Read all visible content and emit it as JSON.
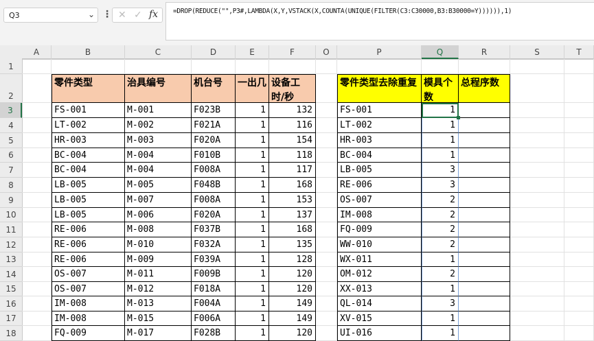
{
  "name_box": {
    "value": "Q3"
  },
  "formula": "=DROP(REDUCE(\"\",P3#,LAMBDA(X,Y,VSTACK(X,COUNTA(UNIQUE(FILTER(C3:C30000,B3:B30000=Y)))))),1)",
  "columns": [
    "A",
    "B",
    "C",
    "D",
    "E",
    "F",
    "O",
    "P",
    "Q",
    "R",
    "S",
    "T"
  ],
  "rows": [
    "1",
    "2",
    "3",
    "4",
    "5",
    "6",
    "7",
    "8",
    "9",
    "10",
    "11",
    "12",
    "13",
    "14",
    "15",
    "16",
    "17",
    "18"
  ],
  "left_table": {
    "headers": [
      "零件类型",
      "治具编号",
      "机台号",
      "一出几",
      "设备工时/秒"
    ],
    "header_color": "#f8cbad",
    "rows": [
      [
        "FS-001",
        "M-001",
        "F023B",
        "1",
        "132"
      ],
      [
        "LT-002",
        "M-002",
        "F021A",
        "1",
        "116"
      ],
      [
        "HR-003",
        "M-003",
        "F020A",
        "1",
        "154"
      ],
      [
        "BC-004",
        "M-004",
        "F010B",
        "1",
        "118"
      ],
      [
        "BC-004",
        "M-004",
        "F008A",
        "1",
        "117"
      ],
      [
        "LB-005",
        "M-005",
        "F048B",
        "1",
        "168"
      ],
      [
        "LB-005",
        "M-007",
        "F008A",
        "1",
        "153"
      ],
      [
        "LB-005",
        "M-006",
        "F020A",
        "1",
        "137"
      ],
      [
        "RE-006",
        "M-008",
        "F037B",
        "1",
        "168"
      ],
      [
        "RE-006",
        "M-010",
        "F032A",
        "1",
        "135"
      ],
      [
        "RE-006",
        "M-009",
        "F039A",
        "1",
        "128"
      ],
      [
        "OS-007",
        "M-011",
        "F009B",
        "1",
        "120"
      ],
      [
        "OS-007",
        "M-012",
        "F018A",
        "1",
        "120"
      ],
      [
        "IM-008",
        "M-013",
        "F004A",
        "1",
        "149"
      ],
      [
        "IM-008",
        "M-015",
        "F006A",
        "1",
        "149"
      ],
      [
        "FQ-009",
        "M-017",
        "F028B",
        "1",
        "120"
      ]
    ]
  },
  "right_table": {
    "headers": [
      "零件类型去除重复",
      "模具个数",
      "总程序数"
    ],
    "header_color": "#ffff00",
    "rows": [
      [
        "FS-001",
        "1",
        ""
      ],
      [
        "LT-002",
        "1",
        ""
      ],
      [
        "HR-003",
        "1",
        ""
      ],
      [
        "BC-004",
        "1",
        ""
      ],
      [
        "LB-005",
        "3",
        ""
      ],
      [
        "RE-006",
        "3",
        ""
      ],
      [
        "OS-007",
        "2",
        ""
      ],
      [
        "IM-008",
        "2",
        ""
      ],
      [
        "FQ-009",
        "2",
        ""
      ],
      [
        "WW-010",
        "2",
        ""
      ],
      [
        "WX-011",
        "1",
        ""
      ],
      [
        "OM-012",
        "2",
        ""
      ],
      [
        "XX-013",
        "1",
        ""
      ],
      [
        "QL-014",
        "3",
        ""
      ],
      [
        "XV-015",
        "1",
        ""
      ],
      [
        "UI-016",
        "1",
        ""
      ]
    ]
  },
  "icons": {
    "cancel": "cancel-icon",
    "enter": "enter-icon",
    "function": "fx-icon",
    "more": "more-icon",
    "dropdown": "chevron-down-icon"
  },
  "accent_color": "#217346"
}
